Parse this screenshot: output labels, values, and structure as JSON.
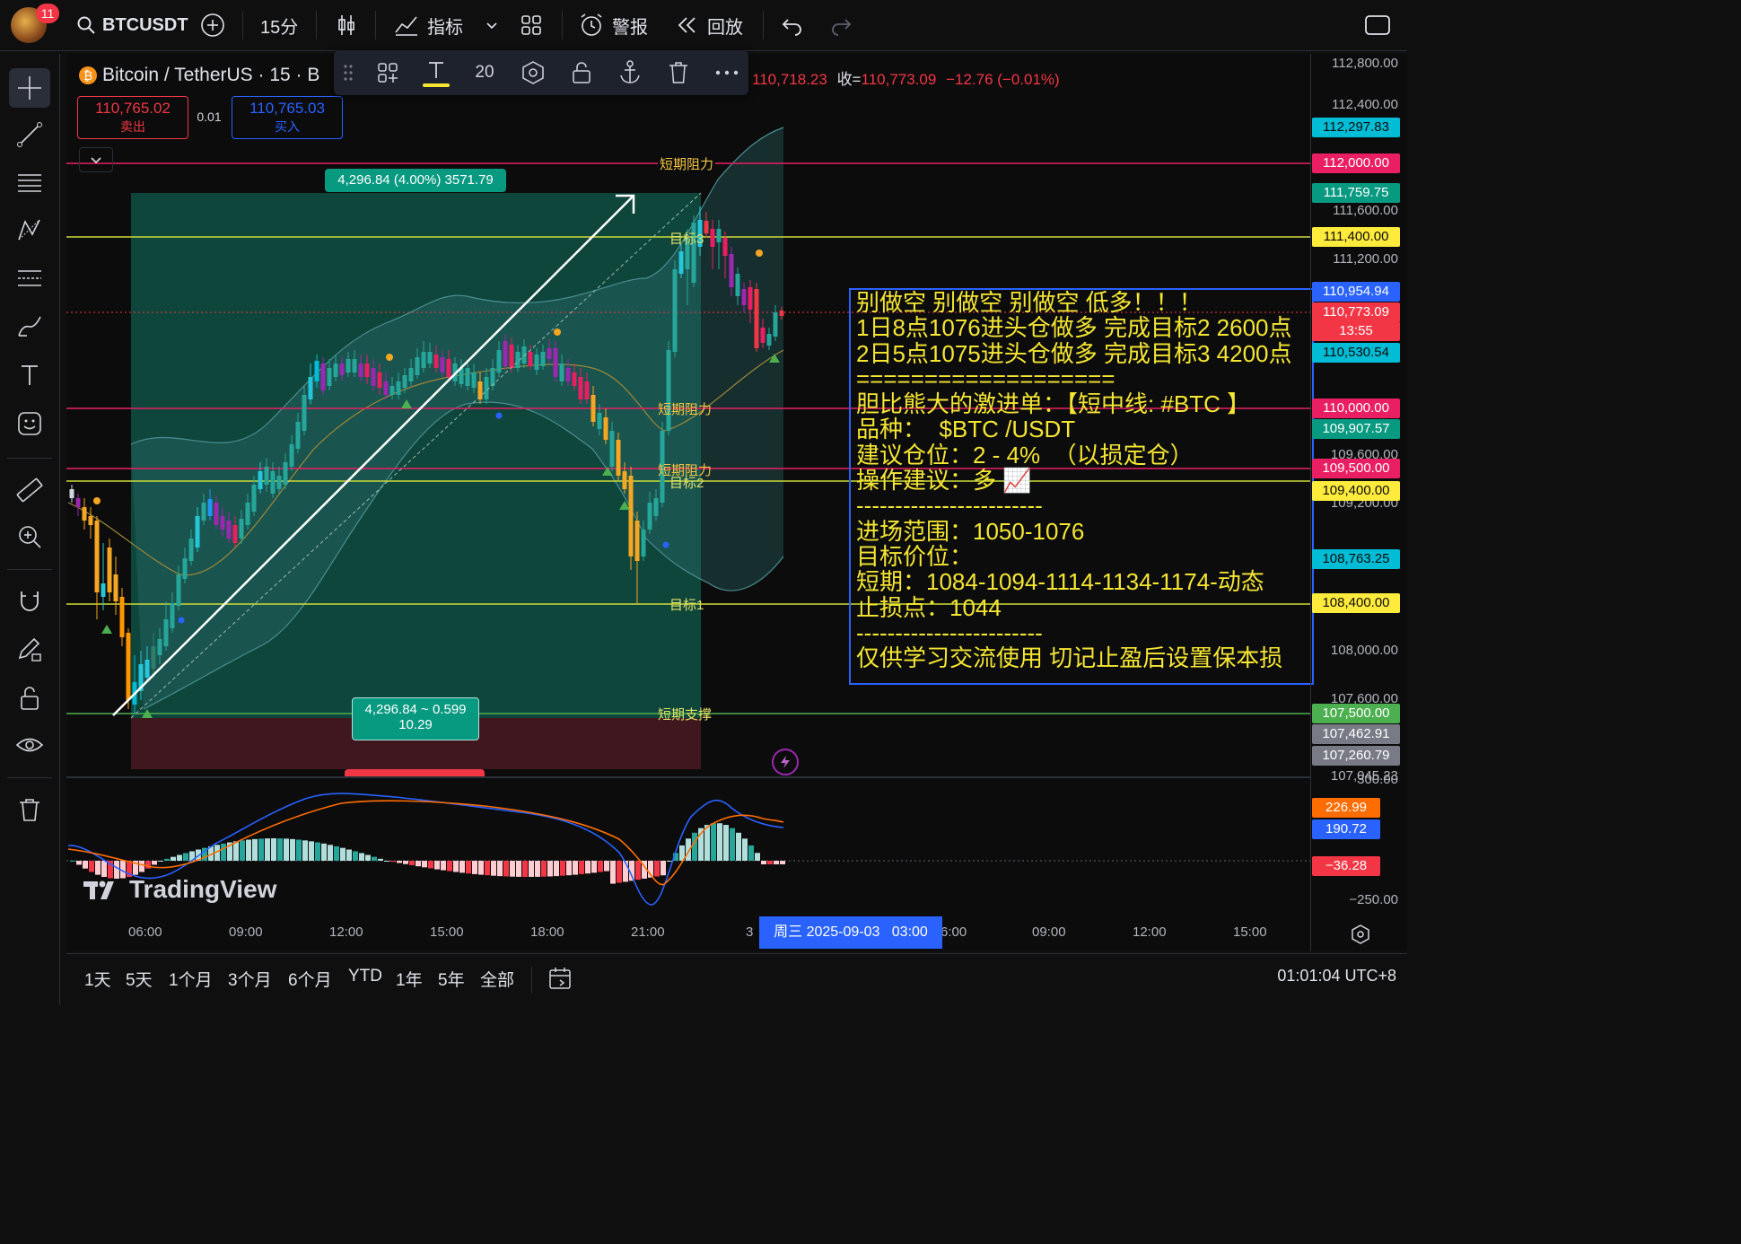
{
  "topbar": {
    "avatar_badge": "11",
    "symbol": "BTCUSDT",
    "interval": "15分",
    "indicators_label": "指标",
    "alert_label": "警报",
    "replay_label": "回放"
  },
  "floating_toolbar": {
    "font_size": "20"
  },
  "legend": {
    "pair": "Bitcoin / TetherUS · 15 · B",
    "ohlc_tail": "110,718.23",
    "close_label": "收=",
    "close_value": "110,773.09",
    "change": "−12.76 (−0.01%)"
  },
  "trade": {
    "sell_price": "110,765.02",
    "sell_label": "卖出",
    "spread": "0.01",
    "buy_price": "110,765.03",
    "buy_label": "买入"
  },
  "position": {
    "target_label": "4,296.84 (4.00%) 3571.79",
    "info_line1": "4,296.84 ~ 0.599",
    "info_line2": "10.29"
  },
  "level_labels": {
    "resist_top": "短期阻力",
    "target3": "目标3",
    "resist_mid": "短期阻力",
    "resist_low": "短期阻力",
    "target2": "目标2",
    "target1": "目标1",
    "support": "短期支撑"
  },
  "note_lines": [
    "别做空 别做空 别做空 低多！！！",
    "1日8点1076进头仓做多 完成目标2 2600点",
    "2日5点1075进头仓做多 完成目标3 4200点",
    "===================",
    "胆比熊大的激进单：【短中线: #BTC 】",
    "品种：  $BTC /USDT",
    "建议仓位：2 - 4%  （以损定仓）",
    "操作建议：多 📈",
    "------------------------",
    "进场范围：1050-1076",
    "目标价位：",
    "短期：1084-1094-1114-1134-1174-动态",
    "止损点：1044",
    "------------------------",
    "仅供学习交流使用 切记止盈后设置保本损"
  ],
  "price_axis": {
    "ticks": [
      "112,800.00",
      "112,400.00",
      "111,600.00",
      "111,200.00",
      "109,600.00",
      "109,200.00",
      "108,000.00",
      "107,600.00",
      "107,045.23"
    ],
    "tags": [
      {
        "text": "112,297.83",
        "bg": "#00bcd4",
        "fg": "#0c0c0c"
      },
      {
        "text": "112,000.00",
        "bg": "#e91e63",
        "fg": "#ffffff"
      },
      {
        "text": "111,759.75",
        "bg": "#089981",
        "fg": "#ffffff"
      },
      {
        "text": "111,400.00",
        "bg": "#ffeb3b",
        "fg": "#0c0c0c"
      },
      {
        "text": "110,954.94",
        "bg": "#2962ff",
        "fg": "#ffffff"
      },
      {
        "text": "110,773.09",
        "bg": "#f23645",
        "fg": "#ffffff"
      },
      {
        "text": "13:55",
        "bg": "#f23645",
        "fg": "#ffffff"
      },
      {
        "text": "110,530.54",
        "bg": "#00bcd4",
        "fg": "#0c0c0c"
      },
      {
        "text": "110,000.00",
        "bg": "#e91e63",
        "fg": "#ffffff"
      },
      {
        "text": "109,907.57",
        "bg": "#089981",
        "fg": "#ffffff"
      },
      {
        "text": "109,500.00",
        "bg": "#e91e63",
        "fg": "#ffffff"
      },
      {
        "text": "109,400.00",
        "bg": "#ffeb3b",
        "fg": "#0c0c0c"
      },
      {
        "text": "108,763.25",
        "bg": "#00bcd4",
        "fg": "#0c0c0c"
      },
      {
        "text": "108,400.00",
        "bg": "#ffeb3b",
        "fg": "#0c0c0c"
      },
      {
        "text": "107,500.00",
        "bg": "#4caf50",
        "fg": "#ffffff"
      },
      {
        "text": "107,462.91",
        "bg": "#787b86",
        "fg": "#ffffff"
      },
      {
        "text": "107,260.79",
        "bg": "#787b86",
        "fg": "#ffffff"
      }
    ]
  },
  "macd_axis": {
    "tick_top": "300.00",
    "tag1": {
      "text": "226.99",
      "bg": "#ff6d00",
      "fg": "#ffffff"
    },
    "tag2": {
      "text": "190.72",
      "bg": "#2962ff",
      "fg": "#ffffff"
    },
    "tag3": {
      "text": "−36.28",
      "bg": "#f23645",
      "fg": "#ffffff"
    },
    "tick_bottom": "−250.00"
  },
  "time_axis": {
    "labels": [
      "06:00",
      "09:00",
      "12:00",
      "15:00",
      "18:00",
      "21:00",
      "3",
      "6:00",
      "09:00",
      "12:00",
      "15:00"
    ],
    "crosshair": "周三 2025-09-03   03:00"
  },
  "watermark": "TradingView",
  "bottombar": {
    "ranges": [
      "1天",
      "5天",
      "1个月",
      "3个月",
      "6个月",
      "YTD",
      "1年",
      "5年",
      "全部"
    ],
    "clock": "01:01:04 UTC+8"
  }
}
